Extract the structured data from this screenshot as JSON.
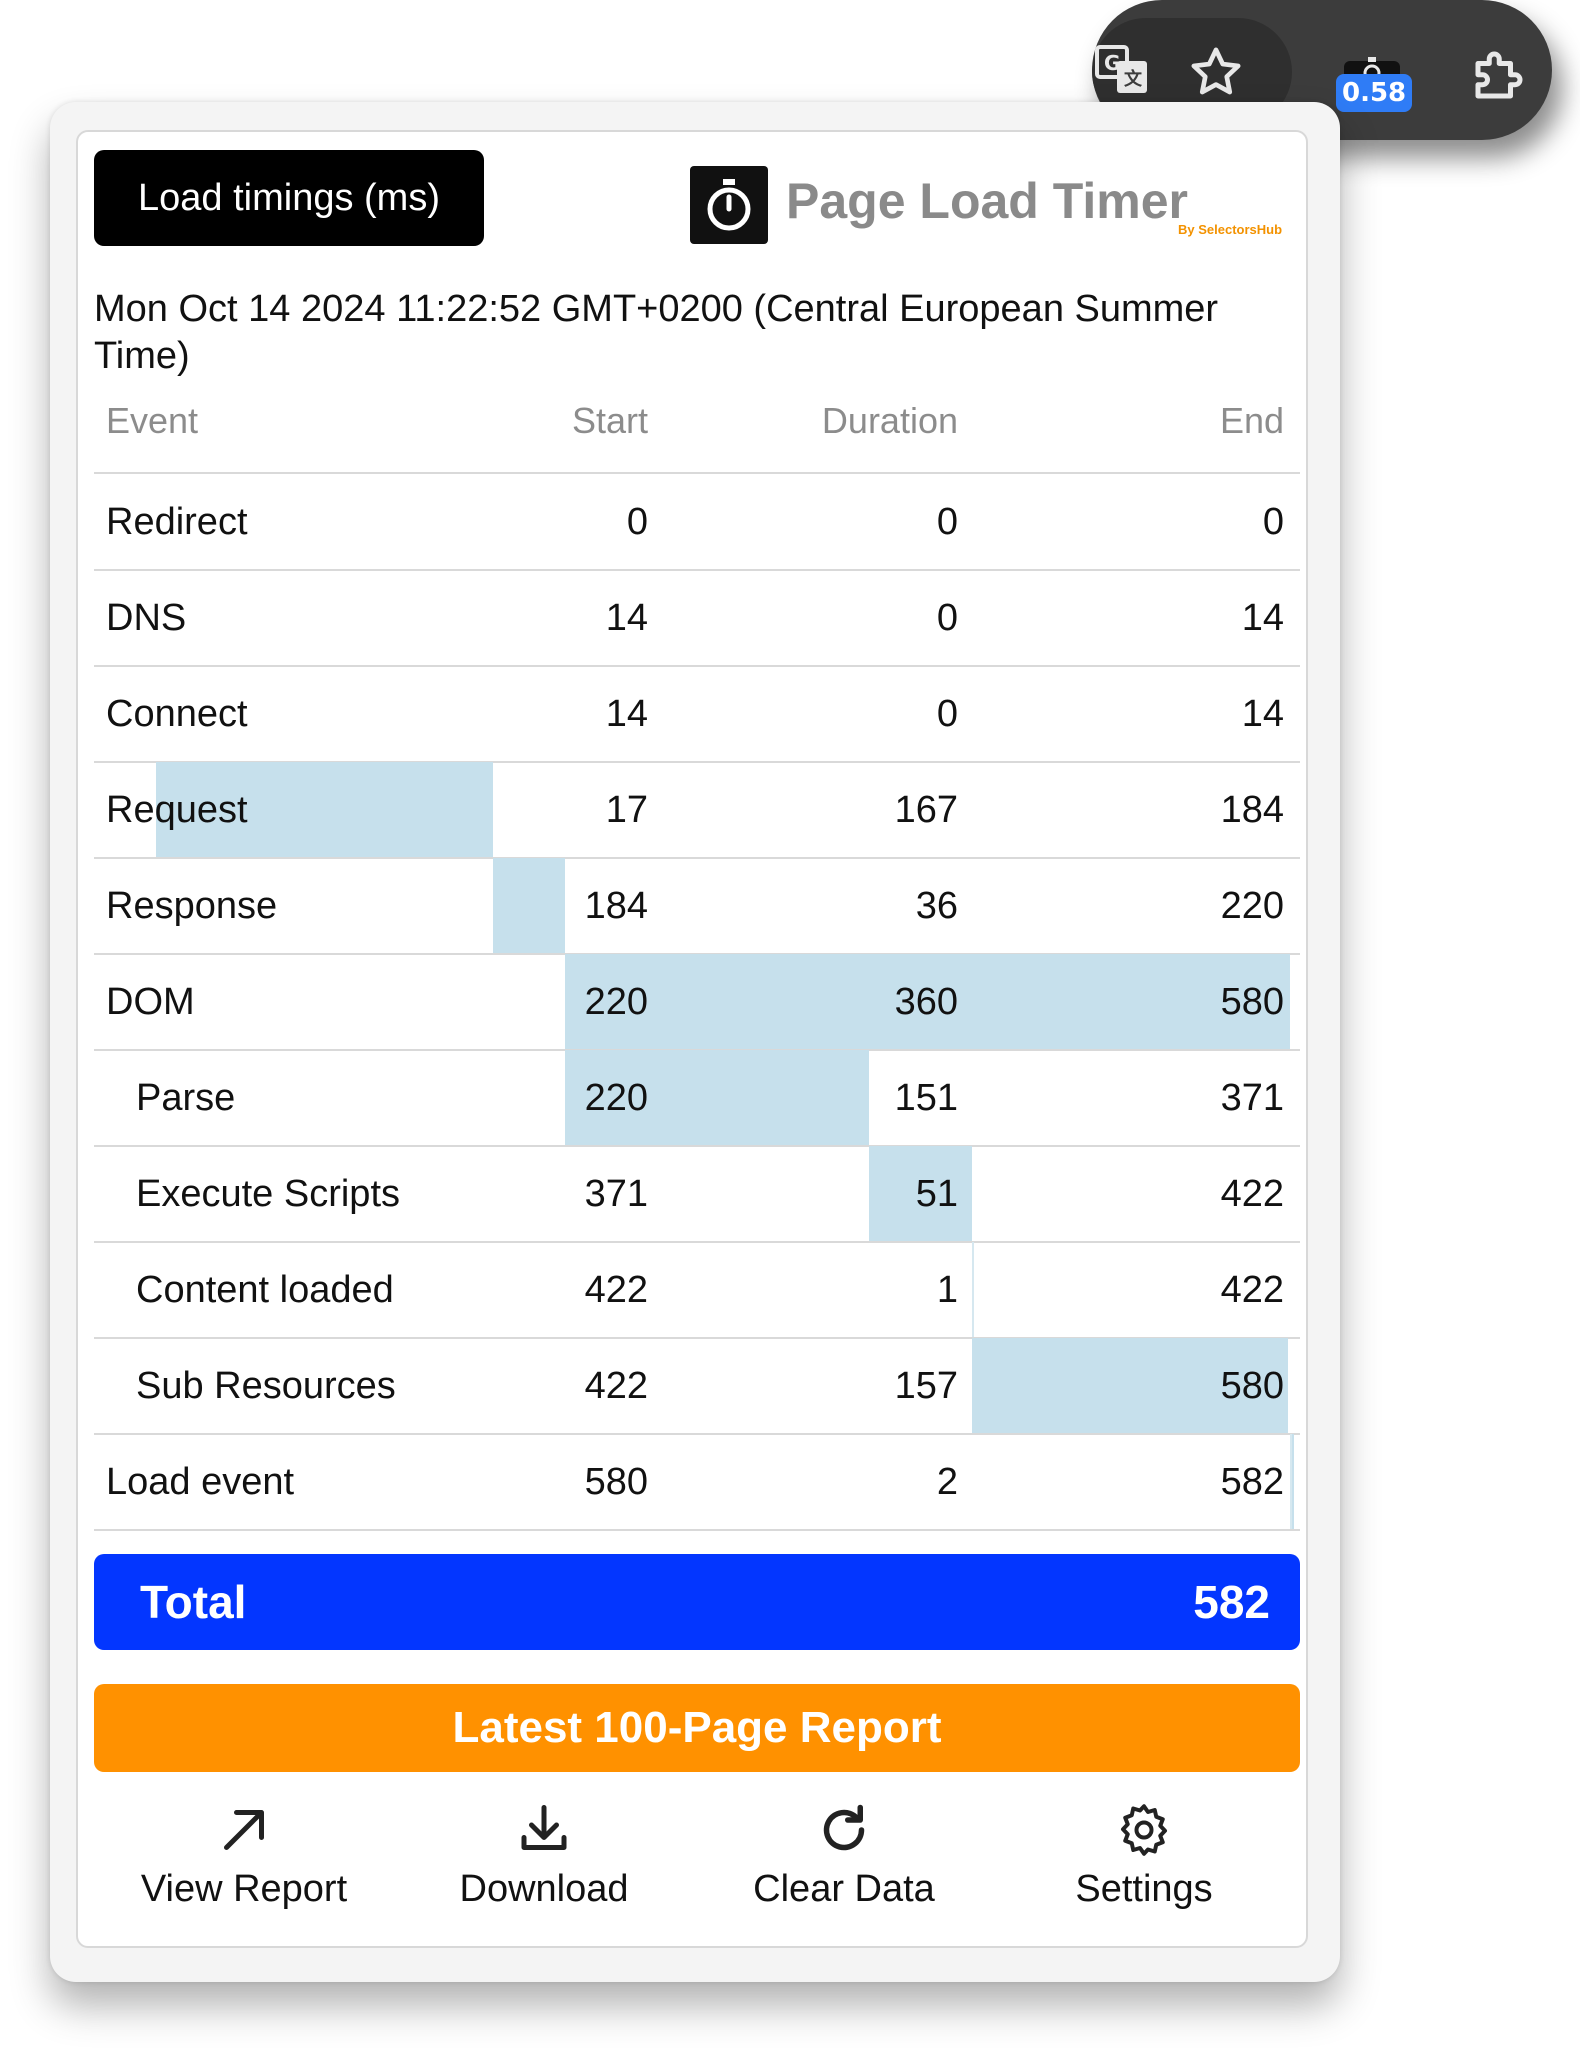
{
  "toolbar": {
    "extension_badge": "0.58",
    "icons": [
      "translate-icon",
      "star-icon",
      "page-load-timer-extension-icon",
      "extensions-puzzle-icon"
    ]
  },
  "header": {
    "load_timings_label": "Load timings (ms)",
    "brand_title": "Page Load Timer",
    "brand_by": "By SelectorsHub"
  },
  "timestamp": "Mon Oct 14 2024 11:22:52 GMT+0200 (Central European Summer Time)",
  "table": {
    "columns": [
      "Event",
      "Start",
      "Duration",
      "End"
    ],
    "total_ms": 582,
    "rows": [
      {
        "event": "Redirect",
        "start": "0",
        "duration": "0",
        "end": "0",
        "indent": false
      },
      {
        "event": "DNS",
        "start": "14",
        "duration": "0",
        "end": "14",
        "indent": false
      },
      {
        "event": "Connect",
        "start": "14",
        "duration": "0",
        "end": "14",
        "indent": false
      },
      {
        "event": "Request",
        "start": "17",
        "duration": "167",
        "end": "184",
        "indent": false
      },
      {
        "event": "Response",
        "start": "184",
        "duration": "36",
        "end": "220",
        "indent": false
      },
      {
        "event": "DOM",
        "start": "220",
        "duration": "360",
        "end": "580",
        "indent": false
      },
      {
        "event": "Parse",
        "start": "220",
        "duration": "151",
        "end": "371",
        "indent": true
      },
      {
        "event": "Execute Scripts",
        "start": "371",
        "duration": "51",
        "end": "422",
        "indent": true
      },
      {
        "event": "Content loaded",
        "start": "422",
        "duration": "1",
        "end": "422",
        "indent": true
      },
      {
        "event": "Sub Resources",
        "start": "422",
        "duration": "157",
        "end": "580",
        "indent": true
      },
      {
        "event": "Load event",
        "start": "580",
        "duration": "2",
        "end": "582",
        "indent": false
      }
    ]
  },
  "total": {
    "label": "Total",
    "value": "582"
  },
  "report_button": "Latest 100-Page Report",
  "actions": [
    {
      "label": "View Report",
      "icon": "arrow-up-right-icon"
    },
    {
      "label": "Download",
      "icon": "download-icon"
    },
    {
      "label": "Clear Data",
      "icon": "refresh-icon"
    },
    {
      "label": "Settings",
      "icon": "gear-icon"
    }
  ],
  "colors": {
    "toolbar": "#3c3c3c",
    "badge": "#2f7cf6",
    "gantt": "#c6e0ec",
    "total_bar": "#0336ff",
    "report_button": "#ff9100",
    "brand_by": "#f39200"
  }
}
